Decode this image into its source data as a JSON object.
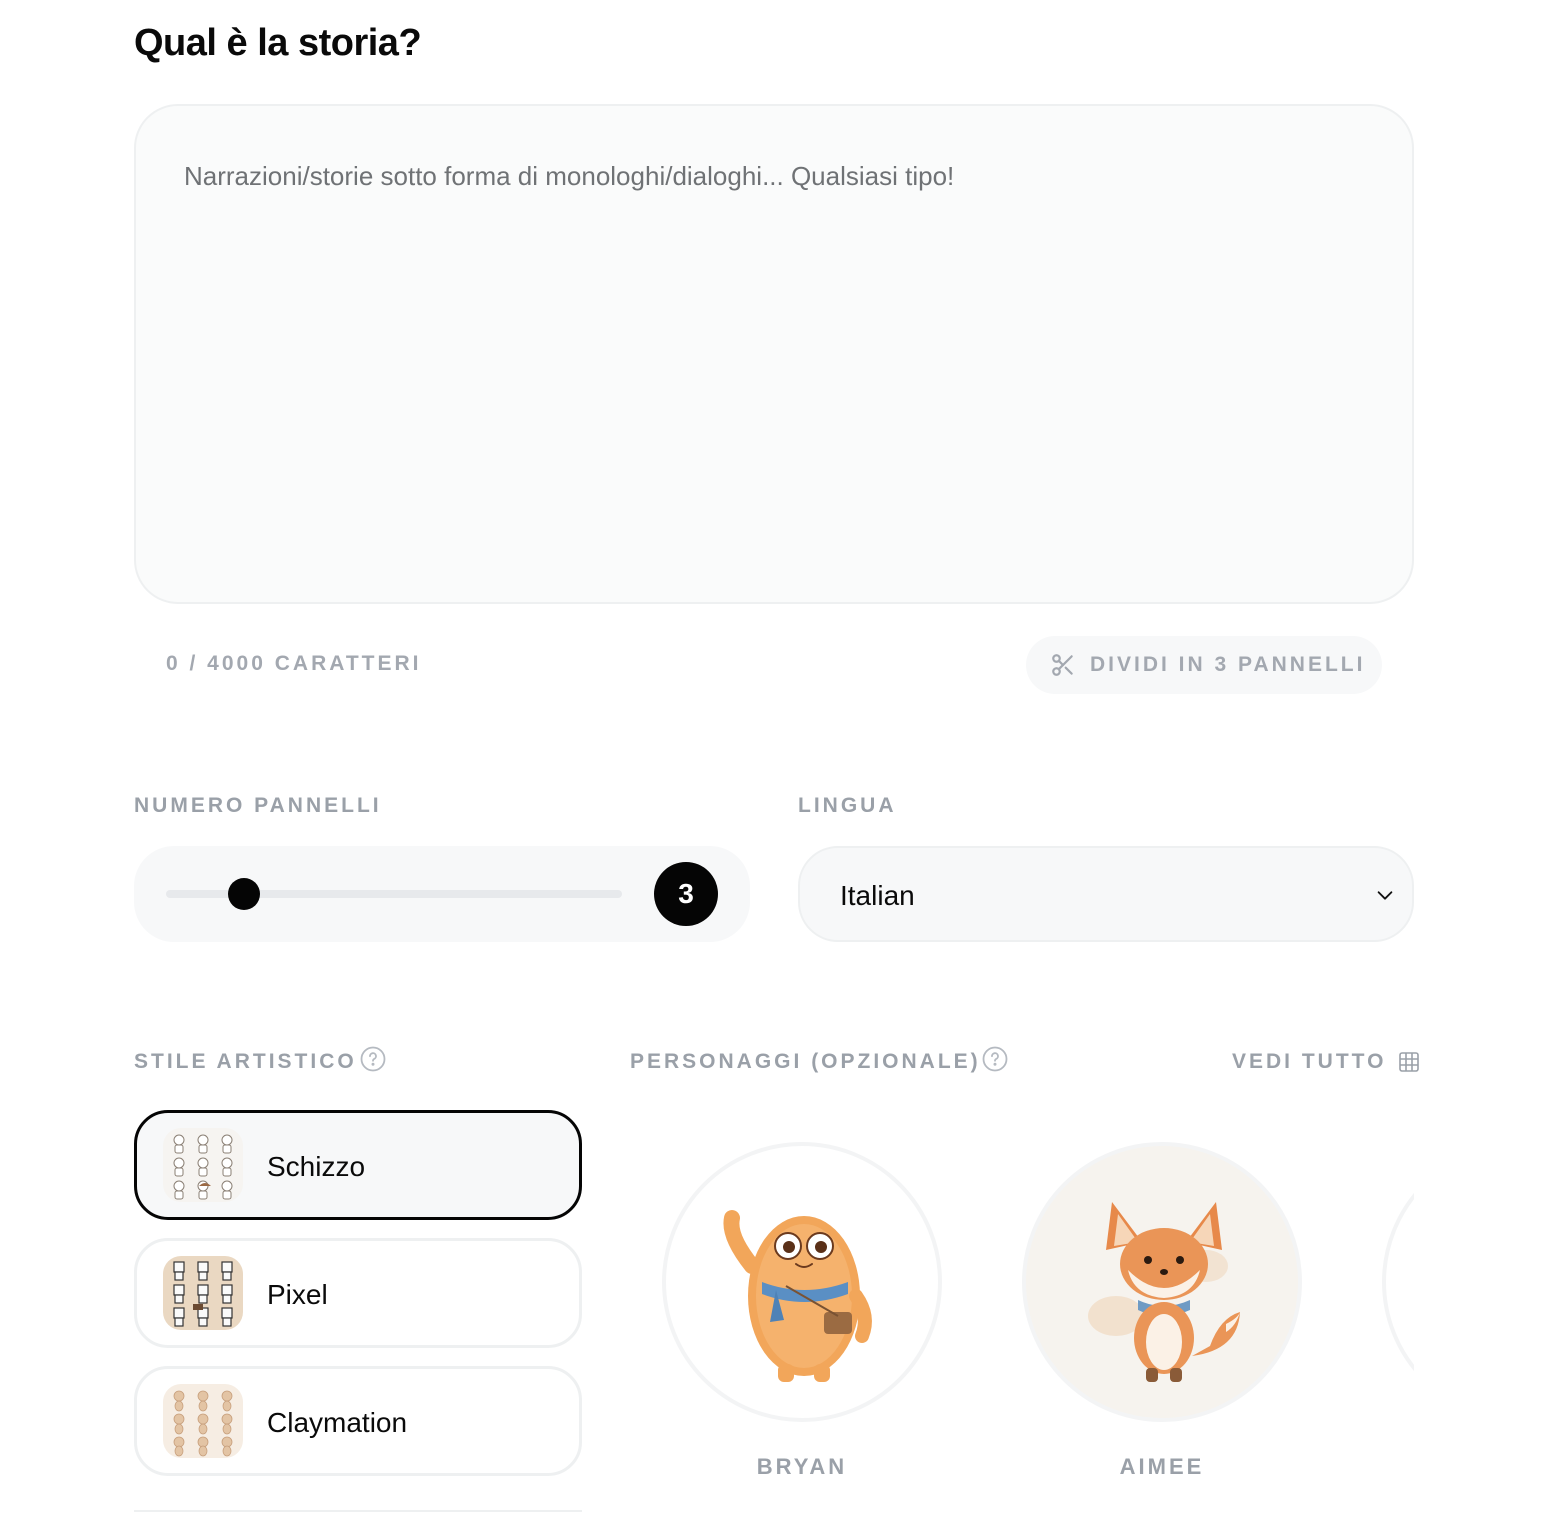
{
  "story": {
    "title": "Qual è la storia?",
    "placeholder": "Narrazioni/storie sotto forma di monologhi/dialoghi... Qualsiasi tipo!",
    "value": "",
    "char_count": "0 / 4000 CARATTERI",
    "split_button_label": "DIVIDI IN 3 PANNELLI"
  },
  "panels": {
    "label": "NUMERO PANNELLI",
    "value": "3",
    "slider_fraction": 0.17
  },
  "language": {
    "label": "LINGUA",
    "selected": "Italian"
  },
  "art_style": {
    "label": "STILE ARTISTICO",
    "items": [
      {
        "name": "Schizzo",
        "selected": true
      },
      {
        "name": "Pixel",
        "selected": false
      },
      {
        "name": "Claymation",
        "selected": false
      }
    ]
  },
  "characters": {
    "label": "PERSONAGGI (OPZIONALE)",
    "view_all_label": "VEDI TUTTO",
    "items": [
      {
        "name": "BRYAN"
      },
      {
        "name": "AIMEE"
      }
    ]
  },
  "colors": {
    "accent": "#050505",
    "muted_text": "#9aa0a8",
    "surface": "#f7f8f9",
    "border": "#eef0f1"
  }
}
